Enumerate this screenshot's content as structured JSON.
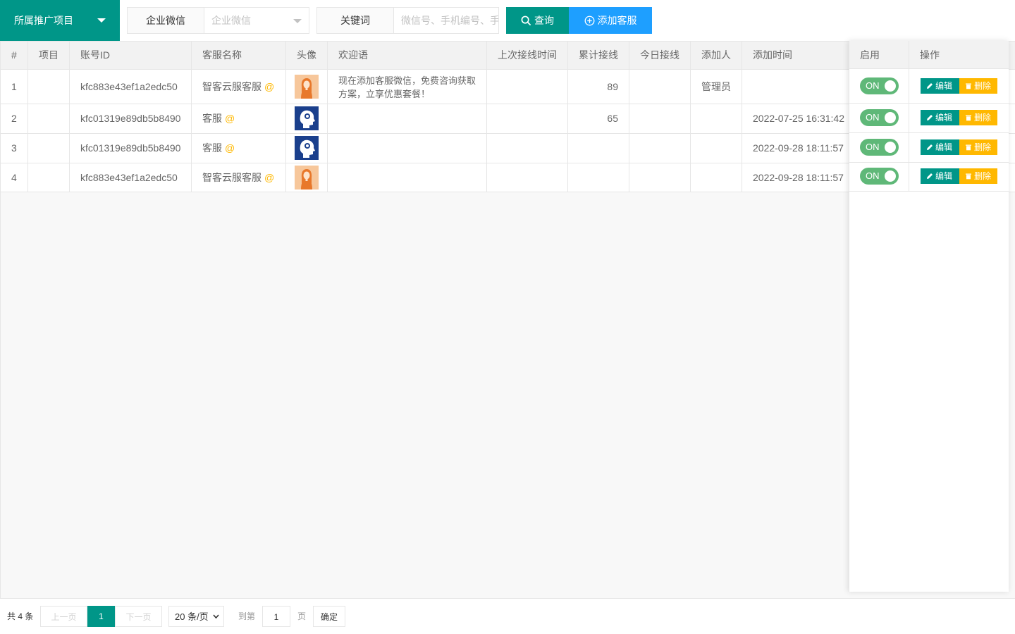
{
  "toolbar": {
    "project_select": "所属推广项目",
    "wecom_label": "企业微信",
    "wecom_select_placeholder": "企业微信",
    "keyword_label": "关键词",
    "keyword_placeholder": "微信号、手机编号、手",
    "query_button": "查询",
    "add_button": "添加客服"
  },
  "table": {
    "headers": {
      "index": "#",
      "project": "项目",
      "account_id": "账号ID",
      "cs_name": "客服名称",
      "avatar": "头像",
      "welcome": "欢迎语",
      "last_time": "上次接线时间",
      "total": "累计接线",
      "today": "今日接线",
      "adder": "添加人",
      "add_time": "添加时间",
      "enabled": "启用",
      "actions": "操作"
    },
    "rows": [
      {
        "index": "1",
        "project": "",
        "account_id": "kfc883e43ef1a2edc50",
        "cs_name": "智客云服客服",
        "at": "@",
        "avatar": "female-avatar",
        "welcome": "现在添加客服微信，免费咨询获取方案，立享优惠套餐！",
        "last_time": "",
        "total": "89",
        "today": "",
        "adder": "管理员",
        "add_time": "",
        "switch": "ON"
      },
      {
        "index": "2",
        "project": "",
        "account_id": "kfc01319e89db5b8490",
        "cs_name": "客服",
        "at": "@",
        "avatar": "head-icon",
        "welcome": "",
        "last_time": "",
        "total": "65",
        "today": "",
        "adder": "",
        "add_time": "2022-07-25 16:31:42",
        "switch": "ON"
      },
      {
        "index": "3",
        "project": "",
        "account_id": "kfc01319e89db5b8490",
        "cs_name": "客服",
        "at": "@",
        "avatar": "head-icon",
        "welcome": "",
        "last_time": "",
        "total": "",
        "today": "",
        "adder": "",
        "add_time": "2022-09-28 18:11:57",
        "switch": "ON"
      },
      {
        "index": "4",
        "project": "",
        "account_id": "kfc883e43ef1a2edc50",
        "cs_name": "智客云服客服",
        "at": "@",
        "avatar": "female-avatar",
        "welcome": "",
        "last_time": "",
        "total": "",
        "today": "",
        "adder": "",
        "add_time": "2022-09-28 18:11:57",
        "switch": "ON"
      }
    ],
    "edit_label": "编辑",
    "delete_label": "删除"
  },
  "pager": {
    "total": "共 4 条",
    "prev": "上一页",
    "current": "1",
    "next": "下一页",
    "page_size": "20 条/页",
    "goto": "到第",
    "goto_value": "1",
    "page_unit": "页",
    "confirm": "确定"
  },
  "colors": {
    "primary": "#009688",
    "blue": "#1e9fff",
    "warn": "#ffb800",
    "switch_on": "#5fb878"
  }
}
